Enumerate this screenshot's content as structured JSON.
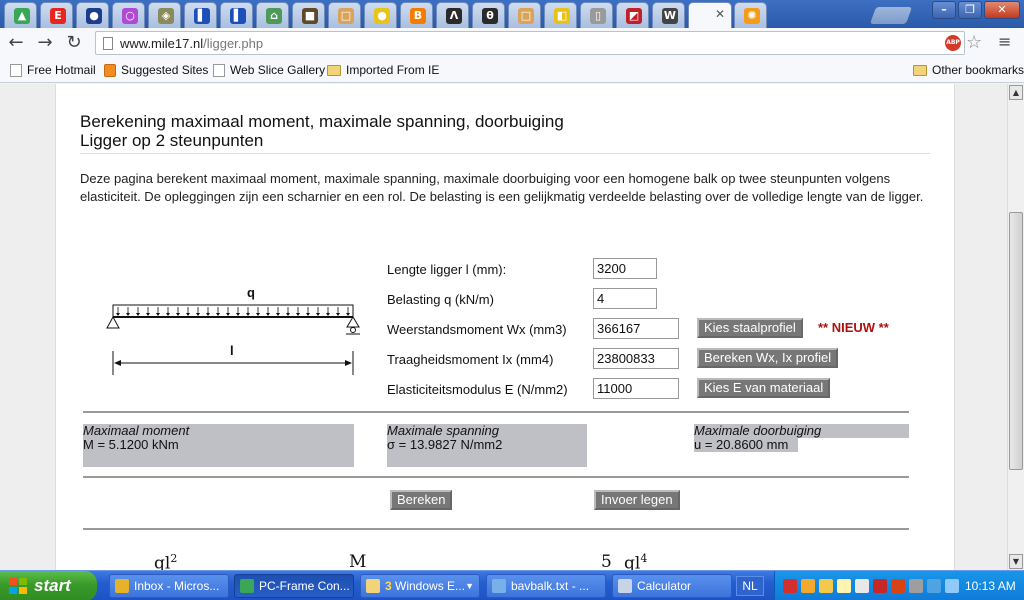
{
  "colors": {
    "titlebar": "#2b5aa9",
    "result_bg": "#bfbfc6",
    "button_bg": "#777777",
    "nieuw": "#b01010",
    "taskbar": "#245ed0",
    "start": "#3a9a2a"
  },
  "browser": {
    "tabs": [
      {
        "icon": "google-drive-icon",
        "color": "#3aa757",
        "glyph": "▲"
      },
      {
        "icon": "e-icon",
        "color": "#e8261f",
        "glyph": "E"
      },
      {
        "icon": "circle-logo-icon",
        "color": "#1b3d8c",
        "glyph": "●"
      },
      {
        "icon": "purple-circle-icon",
        "color": "#b04ad6",
        "glyph": "○"
      },
      {
        "icon": "compass-icon",
        "color": "#8a8a5a",
        "glyph": "◈"
      },
      {
        "icon": "french-flag-icon",
        "color": "#1d4fb8",
        "glyph": "▌"
      },
      {
        "icon": "french-flag-icon",
        "color": "#1d4fb8",
        "glyph": "▌"
      },
      {
        "icon": "shirt-icon",
        "color": "#4e9a58",
        "glyph": "⌂"
      },
      {
        "icon": "bag-icon",
        "color": "#5c4a2a",
        "glyph": "■"
      },
      {
        "icon": "box-icon",
        "color": "#d9a35a",
        "glyph": "□"
      },
      {
        "icon": "smiley-icon",
        "color": "#e8c31a",
        "glyph": "●"
      },
      {
        "icon": "blogger-icon",
        "color": "#f57c00",
        "glyph": "B"
      },
      {
        "icon": "a-icon",
        "color": "#2a2a2a",
        "glyph": "Λ"
      },
      {
        "icon": "theta-icon",
        "color": "#2a2a2a",
        "glyph": "θ"
      },
      {
        "icon": "box-icon",
        "color": "#d9a35a",
        "glyph": "□"
      },
      {
        "icon": "yellow-black-icon",
        "color": "#e6c21a",
        "glyph": "◧"
      },
      {
        "icon": "page-icon",
        "color": "#9a9a9a",
        "glyph": "▯"
      },
      {
        "icon": "flag-icon",
        "color": "#c0202a",
        "glyph": "◩"
      },
      {
        "icon": "wikipedia-icon",
        "color": "#444444",
        "glyph": "W"
      }
    ],
    "active_tab_icon": "sun-icon",
    "url_domain": "www.mile17.nl",
    "url_path": "/ligger.php",
    "bookmarks": [
      {
        "label": "Free Hotmail",
        "icon": "page-icon",
        "kind": "page"
      },
      {
        "label": "Suggested Sites",
        "icon": "suggested-sites-icon",
        "kind": "orange"
      },
      {
        "label": "Web Slice Gallery",
        "icon": "page-icon",
        "kind": "page"
      },
      {
        "label": "Imported From IE",
        "icon": "folder-icon",
        "kind": "folder"
      }
    ],
    "other_bookmarks": "Other bookmarks"
  },
  "page": {
    "title_line1": "Berekening maximaal moment, maximale spanning, doorbuiging",
    "title_line2": "Ligger op 2 steunpunten",
    "intro": "Deze pagina berekent maximaal moment, maximale spanning, maximale doorbuiging voor een homogene balk op twee steunpunten volgens elasticiteit. De opleggingen zijn een scharnier en een rol. De belasting is een gelijkmatig verdeelde belasting over de volledige lengte van de ligger.",
    "diagram": {
      "load_label": "q",
      "length_label": "l"
    },
    "fields": [
      {
        "label": "Lengte ligger l (mm):",
        "value": "3200"
      },
      {
        "label": "Belasting q (kN/m)",
        "value": "4"
      },
      {
        "label": "Weerstandsmoment Wx (mm3)",
        "value": "366167"
      },
      {
        "label": "Traagheidsmoment Ix (mm4)",
        "value": "23800833"
      },
      {
        "label": "Elasticiteitsmodulus E (N/mm2)",
        "value": "11000"
      }
    ],
    "btn_staalprofiel": "Kies staalprofiel",
    "nieuw": "** NIEUW **",
    "btn_bereken_wx": "Bereken Wx, Ix profiel",
    "btn_kies_e": "Kies E van materiaal",
    "results": [
      {
        "label": "Maximaal moment",
        "value": "M = 5.1200 kNm"
      },
      {
        "label": "Maximale spanning",
        "value": "σ = 13.9827 N/mm2"
      },
      {
        "label": "Maximale doorbuiging",
        "value": "u = 20.8600 mm"
      }
    ],
    "btn_bereken": "Bereken",
    "btn_invoer_legen": "Invoer legen",
    "formula_fragments": [
      "ql",
      "2",
      "M",
      "5",
      "ql",
      "4"
    ]
  },
  "taskbar": {
    "start": "start",
    "tasks": [
      {
        "label": "Inbox - Micros...",
        "icon": "outlook-icon",
        "color": "#e6b22a"
      },
      {
        "label": "PC-Frame Con...",
        "icon": "chrome-icon",
        "color": "#3aa757"
      },
      {
        "count": "3",
        "label": "Windows E...",
        "icon": "explorer-folder-icon",
        "color": "#f3d37a"
      },
      {
        "label": "bavbalk.txt - ...",
        "icon": "notepad-icon",
        "color": "#7ab0e8"
      },
      {
        "label": "Calculator",
        "icon": "calculator-icon",
        "color": "#c9d3e6"
      }
    ],
    "language": "NL",
    "clock": "10:13 AM"
  }
}
